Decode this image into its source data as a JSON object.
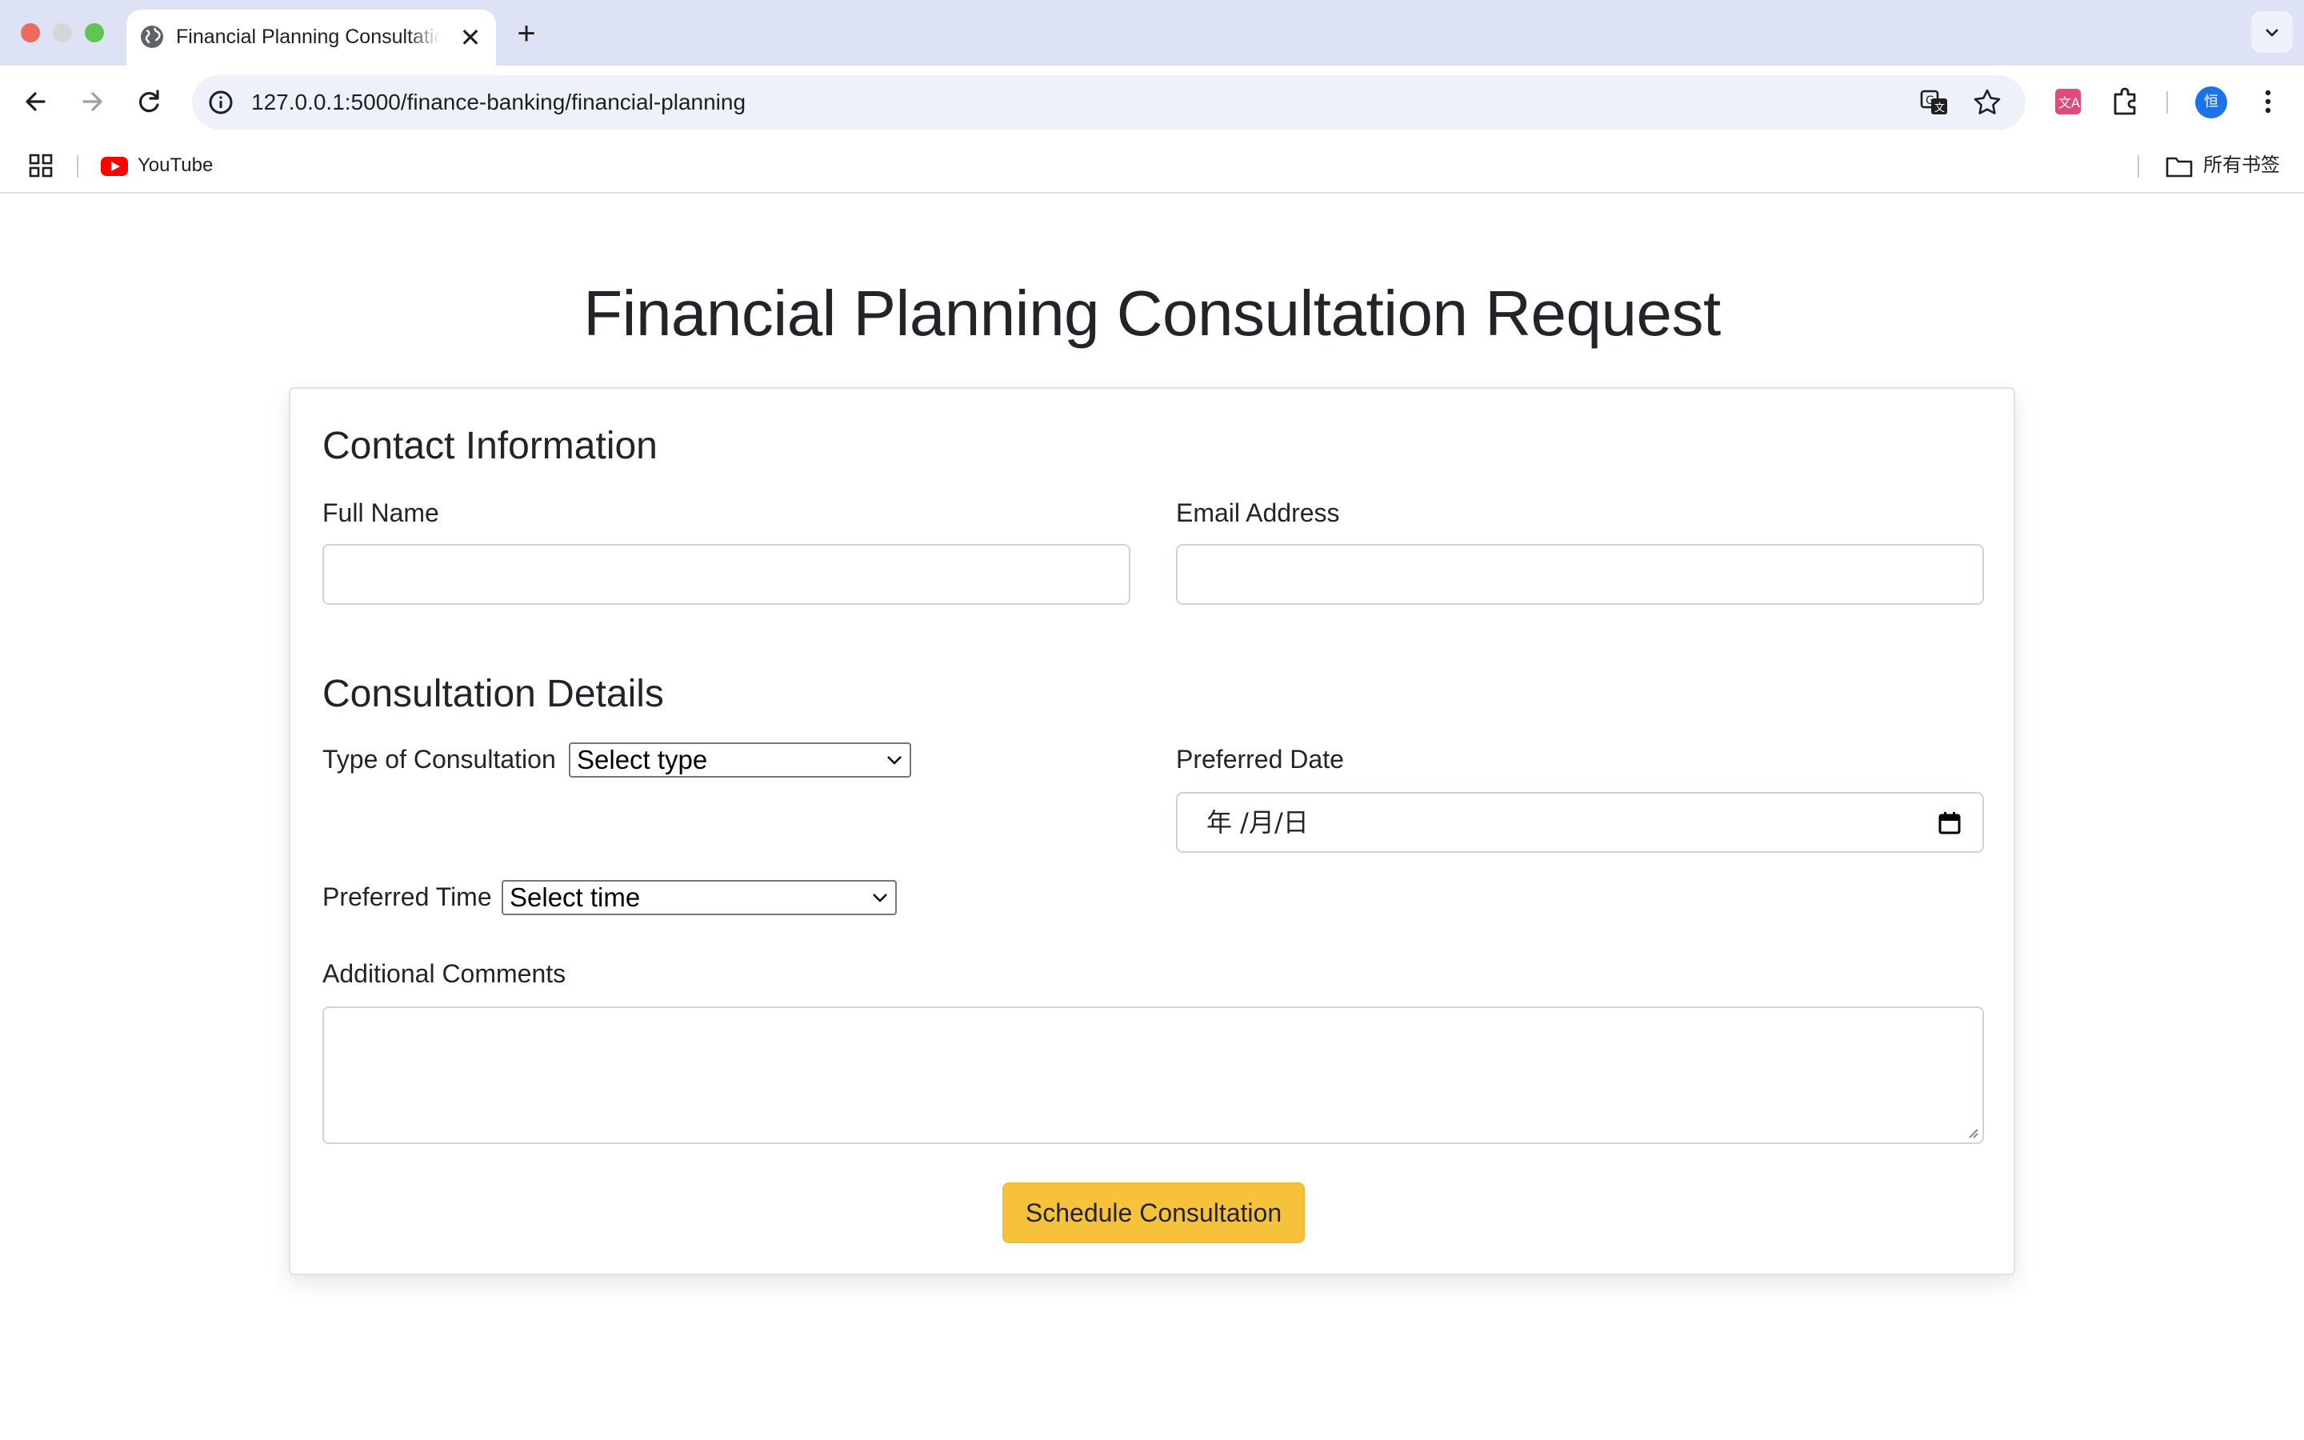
{
  "browser": {
    "tab_title": "Financial Planning Consultation Request",
    "tab_close_glyph": "✕",
    "new_tab_glyph": "+",
    "url": "127.0.0.1:5000/finance-banking/financial-planning",
    "profile_initial": "恒",
    "bookmarks": {
      "items": [
        {
          "label": "YouTube",
          "icon": "youtube-icon"
        }
      ],
      "all_bookmarks_label": "所有书签"
    }
  },
  "page": {
    "title": "Financial Planning Consultation Request",
    "contact": {
      "heading": "Contact Information",
      "full_name_label": "Full Name",
      "full_name_value": "",
      "email_label": "Email Address",
      "email_value": ""
    },
    "consultation": {
      "heading": "Consultation Details",
      "type_label": "Type of Consultation",
      "type_selected": "Select type",
      "date_label": "Preferred Date",
      "date_placeholder": "年 /月/日",
      "time_label": "Preferred Time",
      "time_selected": "Select time",
      "comments_label": "Additional Comments",
      "comments_value": ""
    },
    "submit_label": "Schedule Consultation"
  },
  "colors": {
    "accent_button": "#f7c23b",
    "input_border": "#ced4da",
    "text": "#212529",
    "tabstrip": "#dde3f5"
  }
}
